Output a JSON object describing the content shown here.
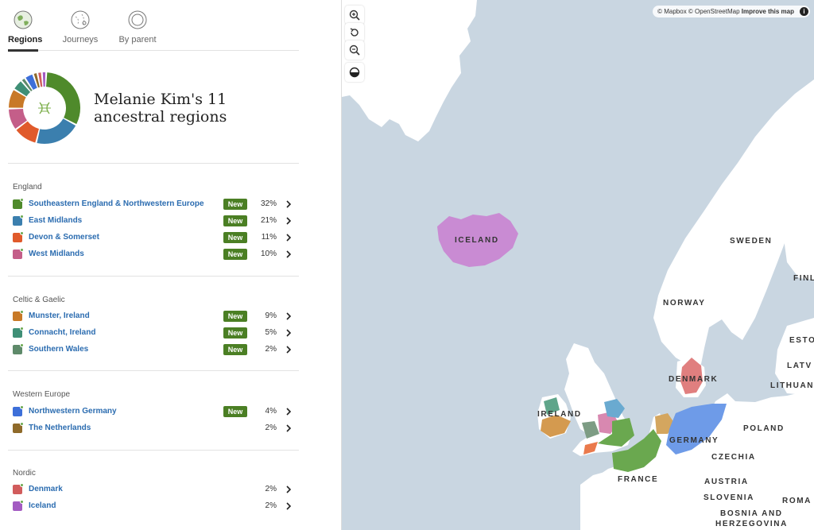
{
  "tabs": [
    {
      "label": "Regions",
      "icon": "globe-regions-icon",
      "active": true
    },
    {
      "label": "Journeys",
      "icon": "globe-journeys-icon",
      "active": false
    },
    {
      "label": "By parent",
      "icon": "globe-parents-icon",
      "active": false
    }
  ],
  "summary": {
    "title": "Melanie Kim's 11 ancestral regions",
    "center_icon": "dna-icon",
    "donut_colors": [
      "#4f8a2b",
      "#3b7fae",
      "#e05a2b",
      "#c45e89",
      "#c87927",
      "#3f8f76",
      "#5e8a6a",
      "#3d6fd9",
      "#8f6a2a",
      "#d15c5c",
      "#a35bc2"
    ]
  },
  "groups": [
    {
      "title": "England",
      "rows": [
        {
          "name": "Southeastern England & Northwestern Europe",
          "badge": "New",
          "pct": "32%",
          "color": "#4f8a2b"
        },
        {
          "name": "East Midlands",
          "badge": "New",
          "pct": "21%",
          "color": "#3b7fae"
        },
        {
          "name": "Devon & Somerset",
          "badge": "New",
          "pct": "11%",
          "color": "#e05a2b"
        },
        {
          "name": "West Midlands",
          "badge": "New",
          "pct": "10%",
          "color": "#c45e89"
        }
      ]
    },
    {
      "title": "Celtic & Gaelic",
      "rows": [
        {
          "name": "Munster, Ireland",
          "badge": "New",
          "pct": "9%",
          "color": "#c87927"
        },
        {
          "name": "Connacht, Ireland",
          "badge": "New",
          "pct": "5%",
          "color": "#3f8f76"
        },
        {
          "name": "Southern Wales",
          "badge": "New",
          "pct": "2%",
          "color": "#5e8a6a"
        }
      ]
    },
    {
      "title": "Western Europe",
      "rows": [
        {
          "name": "Northwestern Germany",
          "badge": "New",
          "pct": "4%",
          "color": "#3d6fd9"
        },
        {
          "name": "The Netherlands",
          "badge": "",
          "pct": "2%",
          "color": "#8f6a2a"
        }
      ]
    },
    {
      "title": "Nordic",
      "rows": [
        {
          "name": "Denmark",
          "badge": "",
          "pct": "2%",
          "color": "#d15c5c"
        },
        {
          "name": "Iceland",
          "badge": "",
          "pct": "2%",
          "color": "#a35bc2"
        }
      ]
    }
  ],
  "map": {
    "controls": [
      "zoom-in-icon",
      "reset-rotation-icon",
      "zoom-out-icon",
      "contrast-icon"
    ],
    "attribution": {
      "mapbox": "© Mapbox",
      "osm": "© OpenStreetMap",
      "improve": "Improve this map",
      "info": "i"
    },
    "labels": [
      "ICELAND",
      "SWEDEN",
      "FINL",
      "NORWAY",
      "ESTO",
      "LATV",
      "LITHUAN",
      "DENMARK",
      "IRELAND",
      "GERMANY",
      "POLAND",
      "CZECHIA",
      "FRANCE",
      "AUSTRIA",
      "SLOVENIA",
      "ROMA",
      "BOSNIA AND",
      "HERZEGOVINA"
    ],
    "colors": {
      "water": "#c9d6e1",
      "land": "#ffffff",
      "iceland": "#c98bd3",
      "germany": "#6e9be8",
      "england_se": "#6aa84f",
      "east_midlands": "#6aaad0"
    }
  }
}
